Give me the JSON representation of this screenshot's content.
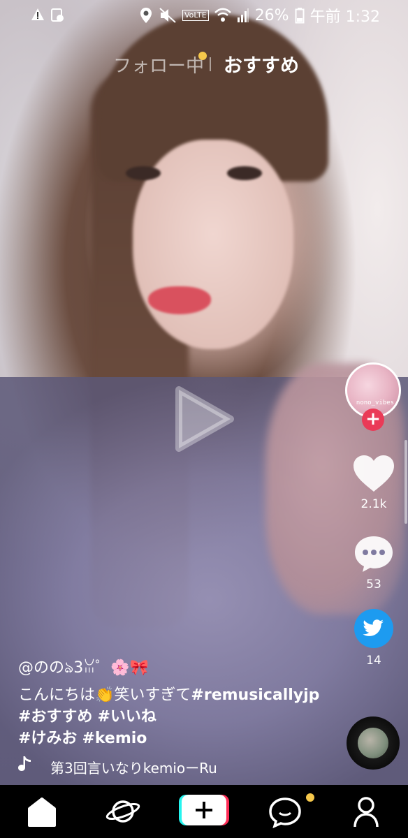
{
  "status_bar": {
    "battery_percent": "26%",
    "time": "午前 1:32",
    "network_label": "VoLTE"
  },
  "top_tabs": {
    "following": "フォロー中",
    "for_you": "おすすめ"
  },
  "author": {
    "avatar_text": "nono_vibes"
  },
  "actions": {
    "likes": "2.1k",
    "comments": "53",
    "shares": "14"
  },
  "caption": {
    "username": "@ののঌ3ꈍ゜🌸🎀",
    "text_part1": "こんにちは👏笑いすぎて",
    "hashtags": [
      "#remusicallyjp",
      "#おすすめ",
      "#いいね",
      "#けみお",
      "#kemio"
    ]
  },
  "music": {
    "title": "第3回言いなりkemioーRu"
  },
  "colors": {
    "accent_red": "#ea3a57",
    "notification_dot": "#f6c84b",
    "twitter_blue": "#1d9bf0"
  },
  "icons": [
    "home-icon",
    "discover-planet-icon",
    "create-plus-icon",
    "inbox-chat-icon",
    "profile-icon",
    "heart-icon",
    "comment-icon",
    "twitter-icon",
    "music-note-icon",
    "play-icon"
  ]
}
